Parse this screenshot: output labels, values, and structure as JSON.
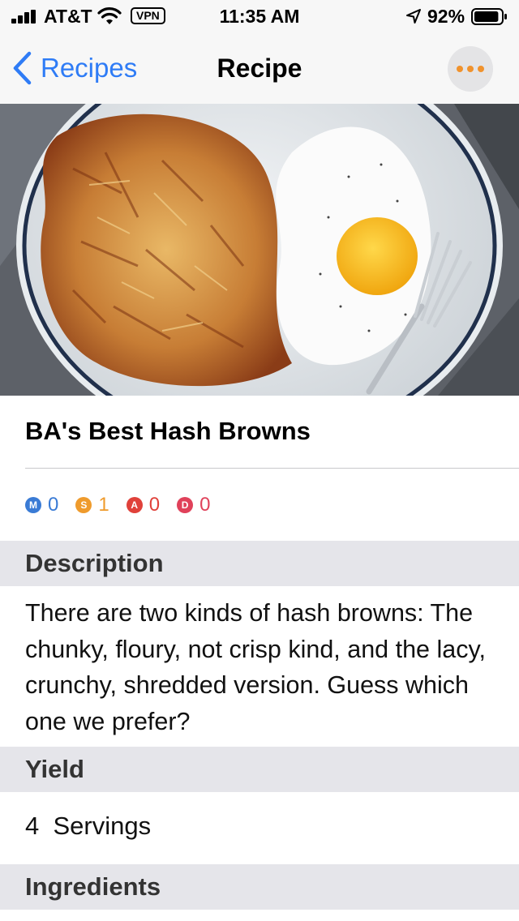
{
  "status_bar": {
    "carrier": "AT&T",
    "vpn": "VPN",
    "time": "11:35 AM",
    "battery_percent": "92%",
    "battery_level": 0.92
  },
  "nav": {
    "back_label": "Recipes",
    "title": "Recipe"
  },
  "recipe": {
    "title": "BA's Best Hash Browns",
    "counters": [
      {
        "letter": "M",
        "value": "0",
        "color": "#3a7bd5"
      },
      {
        "letter": "S",
        "value": "1",
        "color": "#ef9b2c"
      },
      {
        "letter": "A",
        "value": "0",
        "color": "#e0413a"
      },
      {
        "letter": "D",
        "value": "0",
        "color": "#e0415a"
      }
    ],
    "sections": {
      "description_label": "Description",
      "description": "There are two kinds of hash browns: The chunky, floury, not crisp kind, and the lacy, crunchy, shredded version. Guess which one we prefer?",
      "yield_label": "Yield",
      "yield": "4  Servings",
      "ingredients_label": "Ingredients"
    }
  },
  "colors": {
    "accent": "#2f7cf6",
    "more_dots": "#f0922d",
    "section_bg": "#e5e5ea"
  }
}
